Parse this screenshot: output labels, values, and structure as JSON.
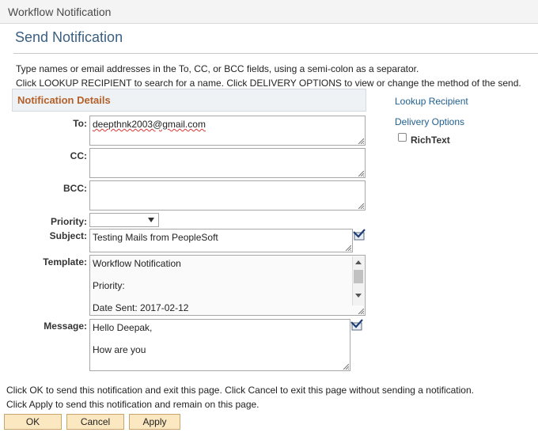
{
  "window": {
    "title": "Workflow Notification"
  },
  "page": {
    "title": "Send Notification",
    "instructions": [
      "Type names or email addresses in the To, CC, or BCC fields, using a semi-colon as a separator.",
      "Click LOOKUP RECIPIENT to search for a name.  Click DELIVERY OPTIONS to view or change the method of the send."
    ]
  },
  "section": {
    "title": "Notification Details"
  },
  "form": {
    "to_label": "To:",
    "to_value": "deepthnk2003@gmail.com",
    "cc_label": "CC:",
    "cc_value": "",
    "bcc_label": "BCC:",
    "bcc_value": "",
    "priority_label": "Priority:",
    "priority_value": "",
    "subject_label": "Subject:",
    "subject_value": "Testing Mails from PeopleSoft",
    "template_label": "Template:",
    "template_lines": [
      "Workflow Notification",
      "Priority:",
      "Date Sent:  2017-02-12"
    ],
    "message_label": "Message:",
    "message_lines": [
      "Hello Deepak,",
      "How are you"
    ]
  },
  "side": {
    "lookup_recipient": "Lookup Recipient",
    "delivery_options": "Delivery Options",
    "richtext_label": "RichText",
    "richtext_checked": false
  },
  "footer": {
    "line1": "Click OK to send this notification and exit this page.  Click Cancel to exit this page without sending a notification.",
    "line2": "Click Apply to send this notification and remain on this page.",
    "ok": "OK",
    "cancel": "Cancel",
    "apply": "Apply"
  }
}
